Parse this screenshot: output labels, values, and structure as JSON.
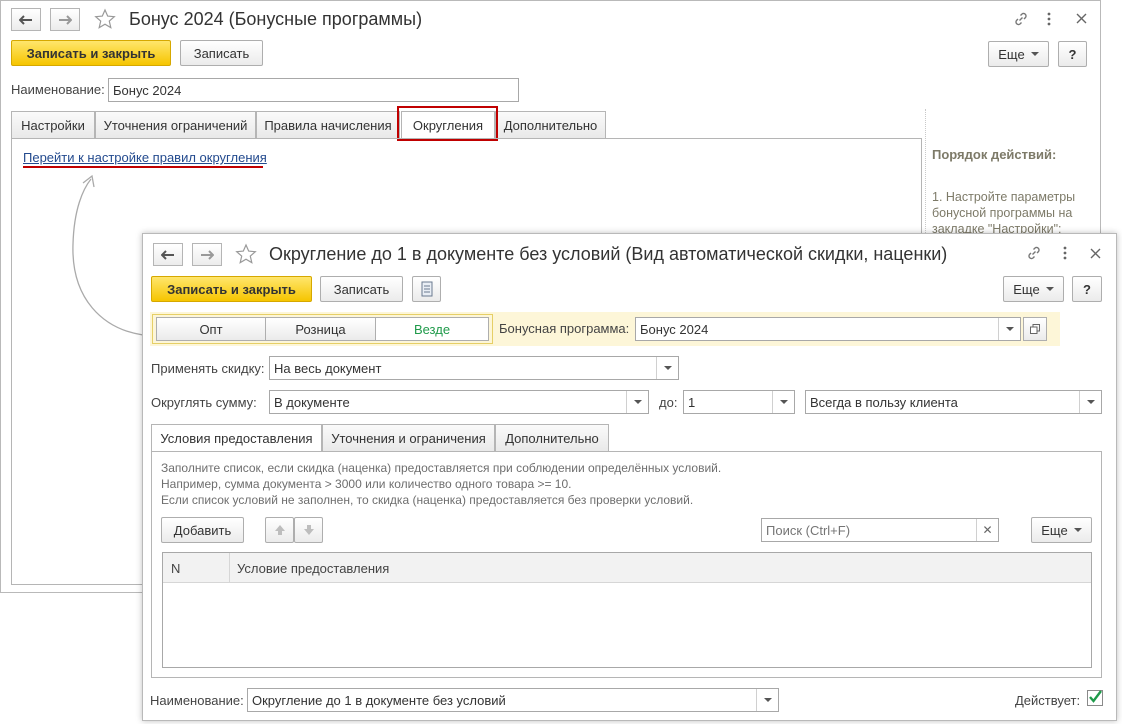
{
  "back": {
    "title": "Бонус 2024 (Бонусные программы)",
    "icons": {
      "back": "arrow-left-icon",
      "forward": "arrow-right-icon",
      "favorite": "star-icon",
      "link": "link-icon",
      "more": "more-vertical-icon",
      "close": "close-icon"
    },
    "toolbar": {
      "save_close": "Записать и закрыть",
      "save": "Записать",
      "more": "Еще",
      "help": "?"
    },
    "name_label": "Наименование:",
    "name_value": "Бонус 2024",
    "tabs": [
      "Настройки",
      "Уточнения ограничений",
      "Правила начисления",
      "Округления",
      "Дополнительно"
    ],
    "active_tab": "Округления",
    "link": "Перейти к настройке правил округления",
    "side": {
      "heading": "Порядок действий:",
      "text": "1. Настройте параметры бонусной программы на закладке \"Настройки\":"
    }
  },
  "front": {
    "title": "Округление до 1 в документе без условий (Вид автоматической скидки, наценки)",
    "toolbar": {
      "save_close": "Записать и закрыть",
      "save": "Записать",
      "more": "Еще",
      "help": "?"
    },
    "segments": [
      "Опт",
      "Розница",
      "Везде"
    ],
    "active_segment": "Везде",
    "bonus_label": "Бонусная программа:",
    "bonus_value": "Бонус 2024",
    "apply_label": "Применять скидку:",
    "apply_value": "На весь документ",
    "round_label": "Округлять сумму:",
    "round_value": "В документе",
    "to_label": "до:",
    "to_value": "1",
    "favor_value": "Всегда в пользу клиента",
    "tabs": [
      "Условия предоставления",
      "Уточнения и ограничения",
      "Дополнительно"
    ],
    "active_tab": "Условия предоставления",
    "hints": [
      "Заполните список, если скидка (наценка) предоставляется при соблюдении определённых условий.",
      "Например, сумма документа > 3000 или количество одного товара >= 10.",
      "Если список условий не заполнен, то скидка (наценка) предоставляется без проверки условий."
    ],
    "add_button": "Добавить",
    "search_placeholder": "Поиск (Ctrl+F)",
    "table_more": "Еще",
    "columns": [
      "N",
      "Условие предоставления"
    ],
    "name_label": "Наименование:",
    "name_value": "Округление до 1 в документе без условий",
    "active_label": "Действует:",
    "active_checked": true
  },
  "colors": {
    "accent_yellow": "#f6c500",
    "highlight_red": "#c00000",
    "segment_active": "#1f9a4a",
    "hint_panel": "#fdf6d8"
  }
}
